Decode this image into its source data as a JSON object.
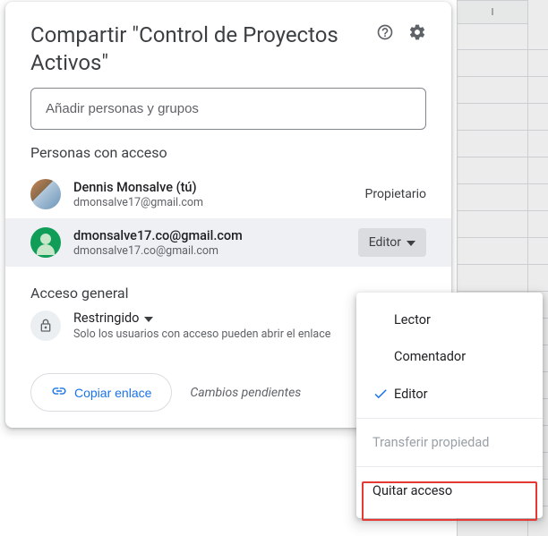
{
  "spreadsheet": {
    "column_label": "I"
  },
  "dialog": {
    "title": "Compartir \"Control de Proyectos Activos\"",
    "add_placeholder": "Añadir personas y grupos",
    "people_section_title": "Personas con acceso",
    "people": [
      {
        "name": "Dennis Monsalve (tú)",
        "email": "dmonsalve17@gmail.com",
        "role": "Propietario",
        "role_editable": false
      },
      {
        "name": "dmonsalve17.co@gmail.com",
        "email": "dmonsalve17.co@gmail.com",
        "role": "Editor",
        "role_editable": true
      }
    ],
    "general_section_title": "Acceso general",
    "general": {
      "mode": "Restringido",
      "sub": "Solo los usuarios con acceso pueden abrir el enlace"
    },
    "copy_link_label": "Copiar enlace",
    "pending_text": "Cambios pendientes"
  },
  "role_menu": {
    "options": [
      {
        "label": "Lector",
        "checked": false
      },
      {
        "label": "Comentador",
        "checked": false
      },
      {
        "label": "Editor",
        "checked": true
      }
    ],
    "transfer_label": "Transferir propiedad",
    "remove_label": "Quitar acceso"
  }
}
